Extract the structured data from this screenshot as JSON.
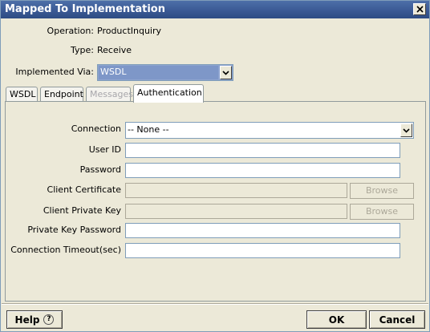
{
  "window": {
    "title": "Mapped To Implementation"
  },
  "header": {
    "operation_label": "Operation:",
    "operation_value": "ProductInquiry",
    "type_label": "Type:",
    "type_value": "Receive",
    "implemented_via_label": "Implemented Via:",
    "implemented_via_value": "WSDL"
  },
  "tabs": [
    {
      "label": "WSDL",
      "state": "normal"
    },
    {
      "label": "Endpoint",
      "state": "normal"
    },
    {
      "label": "Messages",
      "state": "disabled"
    },
    {
      "label": "Authentication",
      "state": "active"
    }
  ],
  "form": {
    "connection_label": "Connection",
    "connection_value": "-- None --",
    "user_id_label": "User ID",
    "user_id_value": "",
    "password_label": "Password",
    "password_value": "",
    "client_certificate_label": "Client Certificate",
    "client_certificate_value": "",
    "client_private_key_label": "Client Private Key",
    "client_private_key_value": "",
    "private_key_password_label": "Private Key Password",
    "private_key_password_value": "",
    "connection_timeout_label": "Connection Timeout(sec)",
    "connection_timeout_value": "",
    "browse_label": "Browse"
  },
  "footer": {
    "help_label": "Help",
    "help_icon": "?",
    "ok_label": "OK",
    "cancel_label": "Cancel"
  },
  "colors": {
    "titlebar": "#3b5a95",
    "selected_combo": "#7e97c8",
    "window_bg": "#ece9d8"
  }
}
